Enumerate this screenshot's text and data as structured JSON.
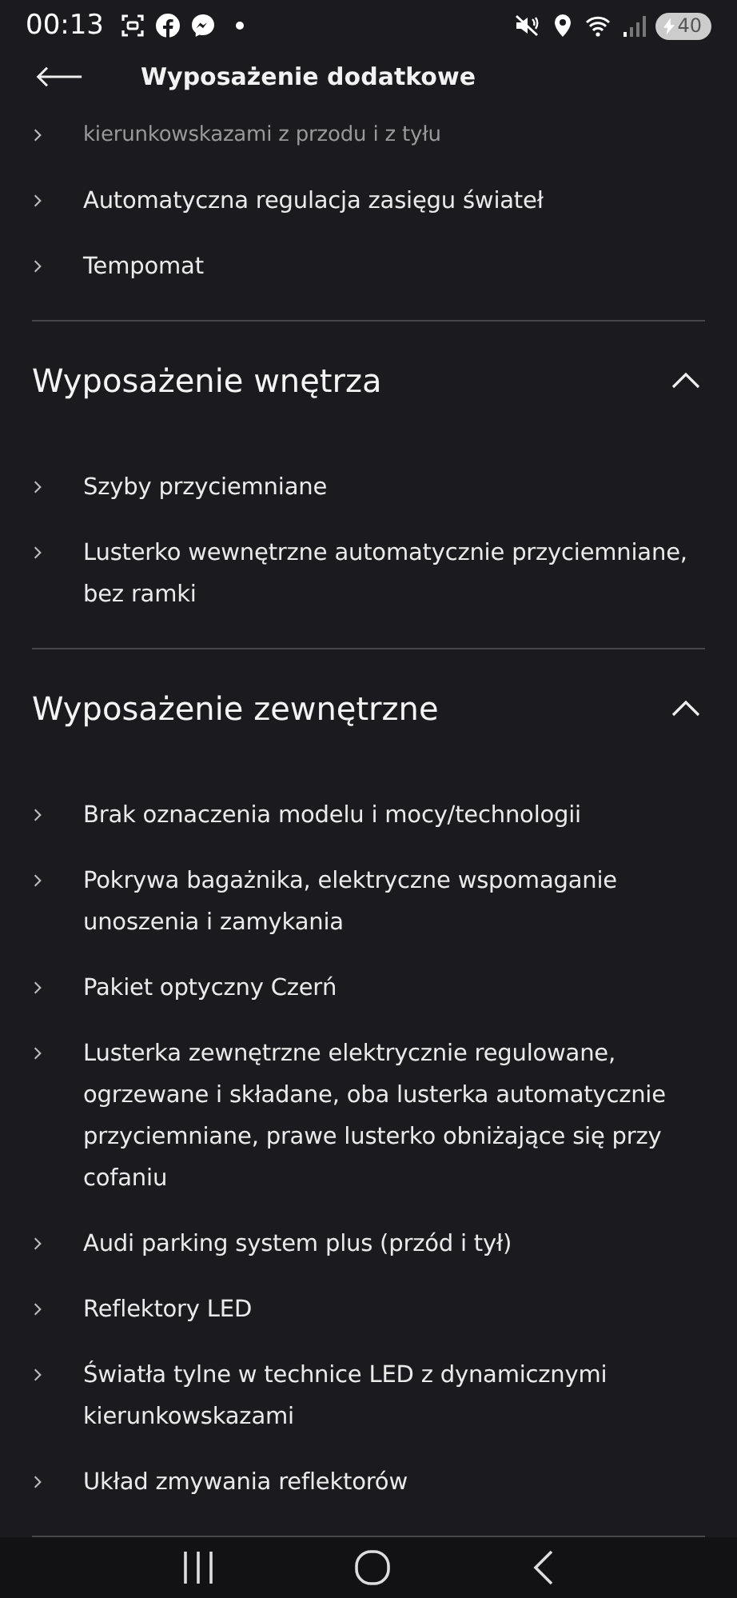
{
  "status_bar": {
    "time": "00:13",
    "battery": "40"
  },
  "header": {
    "title": "Wyposażenie dodatkowe"
  },
  "leading_items": [
    "kierunkowskazami z przodu i z tyłu",
    "Automatyczna regulacja zasięgu świateł",
    "Tempomat"
  ],
  "sections": [
    {
      "title": "Wyposażenie wnętrza",
      "expanded": true,
      "items": [
        "Szyby przyciemniane",
        "Lusterko wewnętrzne automatycznie przyciemniane, bez ramki"
      ]
    },
    {
      "title": "Wyposażenie zewnętrzne",
      "expanded": true,
      "items": [
        "Brak oznaczenia modelu i mocy/technologii",
        "Pokrywa bagażnika, elektryczne wspomaganie unoszenia i zamykania",
        "Pakiet optyczny Czerń",
        "Lusterka zewnętrzne elektrycznie regulowane, ogrzewane i składane, oba lusterka automatycznie przyciemniane, prawe lusterko obniżające się przy cofaniu",
        "Audi parking system plus (przód i tył)",
        "Reflektory LED",
        "Światła tylne w technice LED z dynamicznymi kierunkowskazami",
        "Układ zmywania reflektorów"
      ]
    }
  ]
}
